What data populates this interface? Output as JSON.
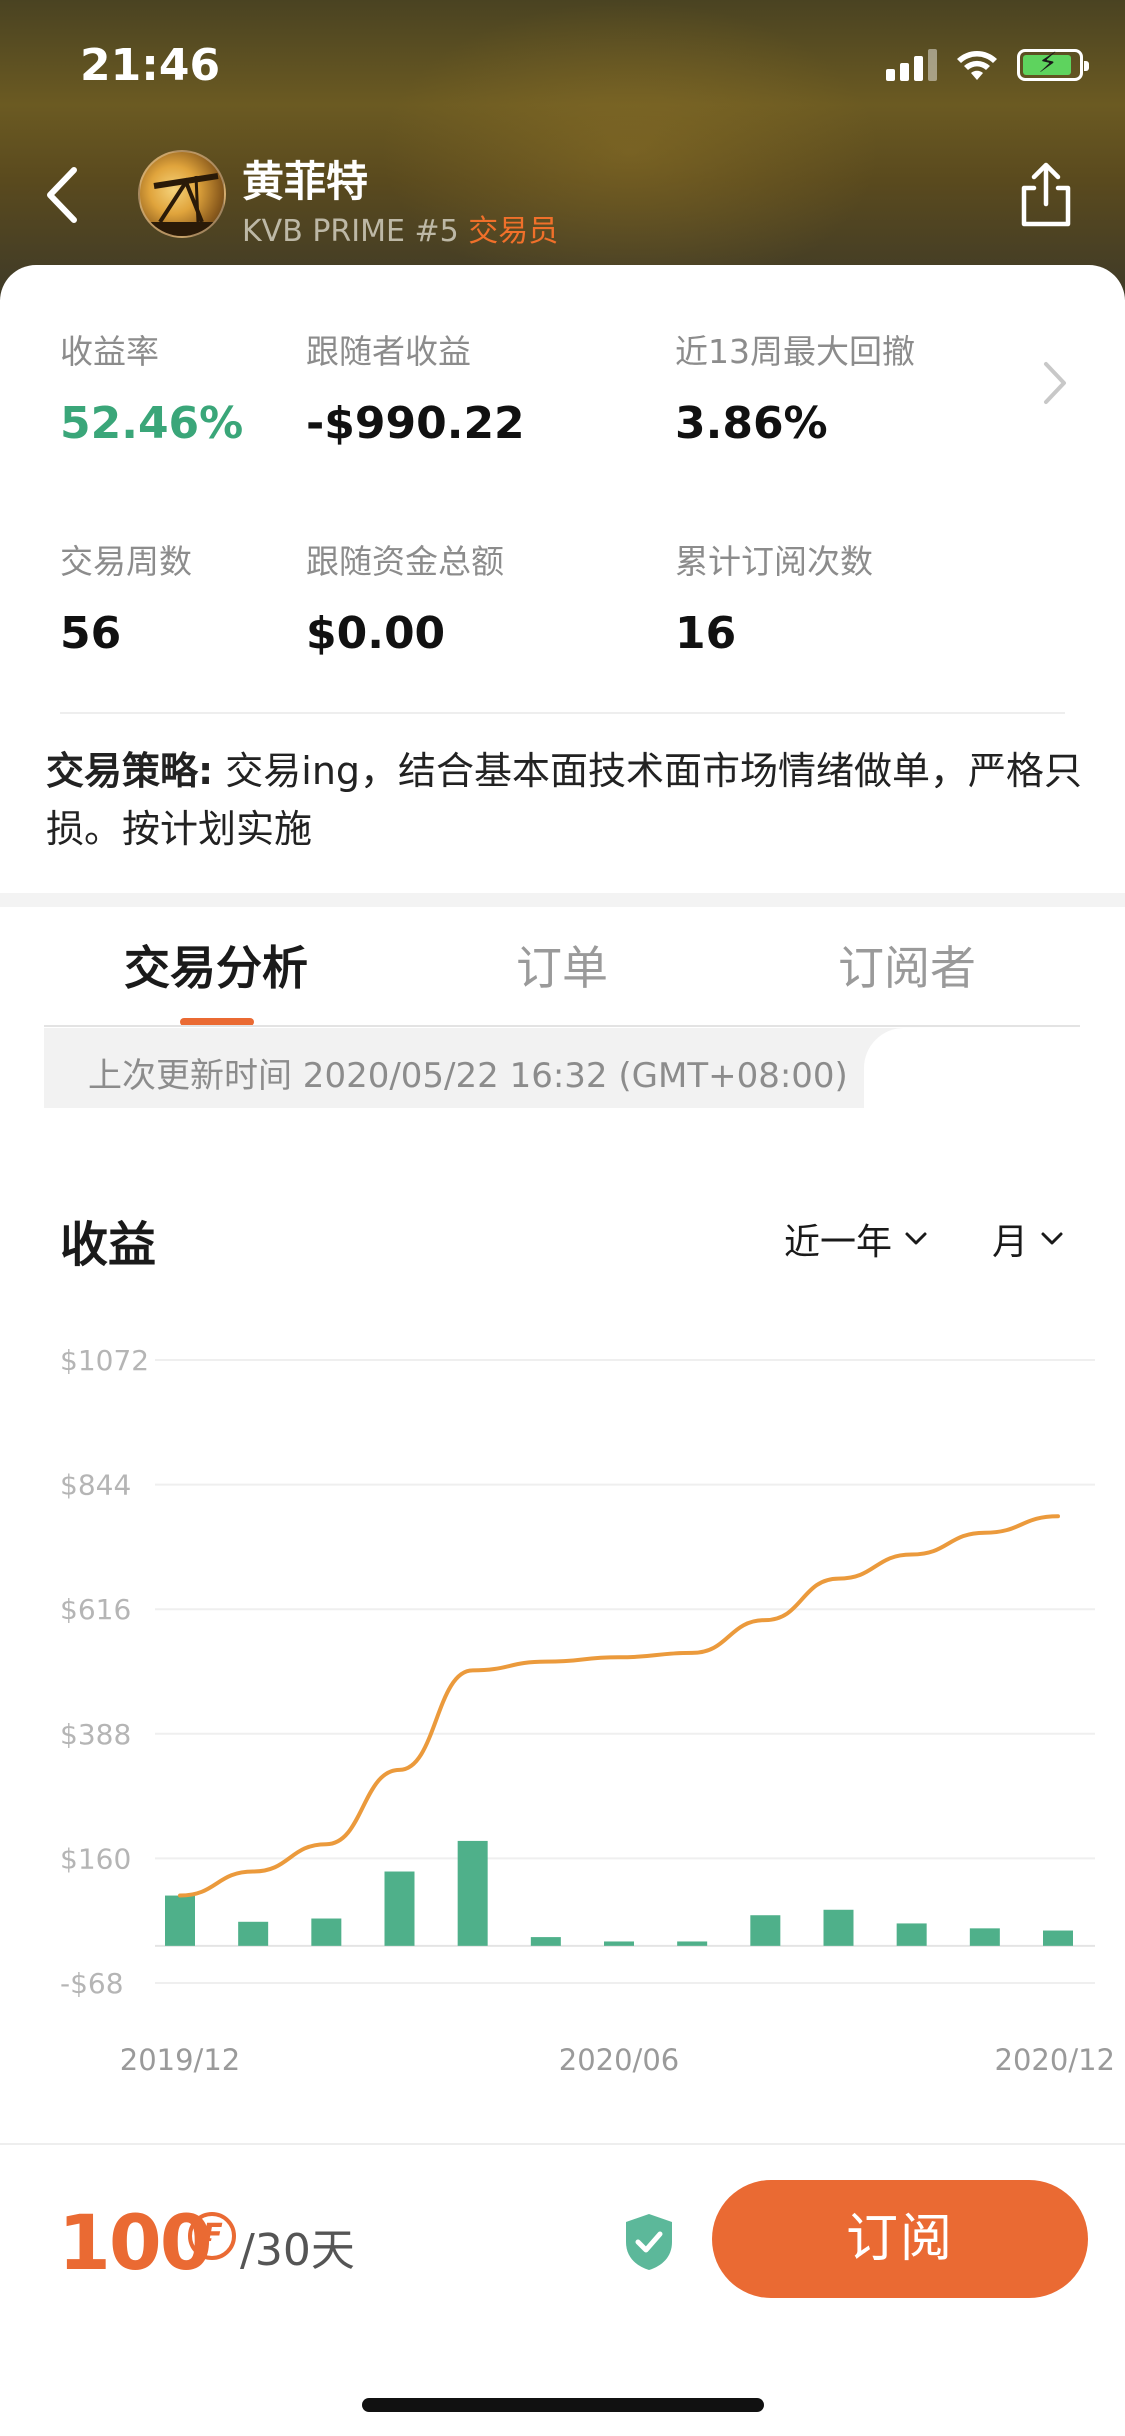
{
  "status_bar": {
    "time": "21:46"
  },
  "trader": {
    "name": "黄菲特",
    "subtitle": "KVB PRIME #5",
    "role": "交易员"
  },
  "stats": {
    "return_rate": {
      "label": "收益率",
      "value": "52.46%"
    },
    "follower_profit": {
      "label": "跟随者收益",
      "value": "-$990.22"
    },
    "max_drawdown": {
      "label": "近13周最大回撤",
      "value": "3.86%"
    },
    "trading_weeks": {
      "label": "交易周数",
      "value": "56"
    },
    "follow_funds": {
      "label": "跟随资金总额",
      "value": "$0.00"
    },
    "subscriptions": {
      "label": "累计订阅次数",
      "value": "16"
    }
  },
  "strategy": {
    "label": "交易策略:",
    "text": " 交易ing，结合基本面技术面市场情绪做单，严格只损。按计划实施"
  },
  "tabs": [
    {
      "label": "交易分析",
      "active": true
    },
    {
      "label": "订单",
      "active": false
    },
    {
      "label": "订阅者",
      "active": false
    }
  ],
  "update_info": "上次更新时间 2020/05/22 16:32 (GMT+08:00)",
  "profit_section": {
    "title": "收益",
    "period_filter": "近一年",
    "granularity_filter": "月"
  },
  "chart_data": {
    "type": "bar+line",
    "y_tick_labels": [
      "$1072",
      "$844",
      "$616",
      "$388",
      "$160",
      "-$68"
    ],
    "y_ticks": [
      1072,
      844,
      616,
      388,
      160,
      -68
    ],
    "ylim": [
      -68,
      1072
    ],
    "x_tick_labels": [
      "2019/12",
      "2020/06",
      "2020/12"
    ],
    "categories": [
      "2019/12",
      "2020/01",
      "2020/02",
      "2020/03",
      "2020/04",
      "2020/05",
      "2020/06",
      "2020/07",
      "2020/08",
      "2020/09",
      "2020/10",
      "2020/11",
      "2020/12"
    ],
    "series": [
      {
        "type": "bar",
        "color": "#4fb08a",
        "values": [
          92,
          44,
          50,
          136,
          192,
          16,
          8,
          8,
          56,
          66,
          41,
          32,
          28
        ]
      },
      {
        "type": "line",
        "color": "#eb9a3c",
        "values": [
          92,
          136,
          186,
          322,
          504,
          520,
          528,
          536,
          596,
          672,
          716,
          756,
          786
        ]
      }
    ],
    "grid": true
  },
  "footer": {
    "price": "100",
    "coin_symbol": "₣",
    "price_unit": "/30天",
    "subscribe_label": "订阅"
  }
}
